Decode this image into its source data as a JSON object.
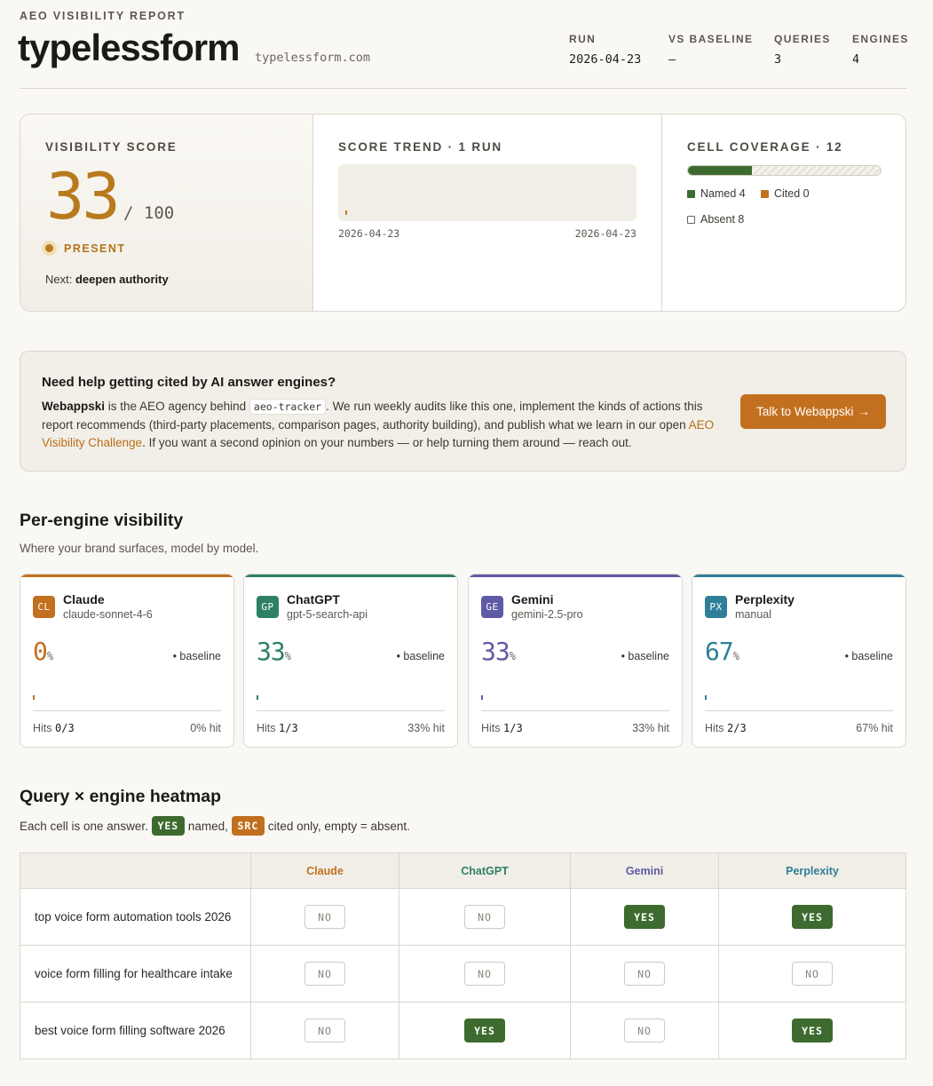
{
  "header": {
    "eyebrow": "AEO VISIBILITY REPORT",
    "brand": "typelessform",
    "domain": "typelessform.com",
    "meta": [
      {
        "label": "RUN",
        "value": "2026-04-23"
      },
      {
        "label": "VS BASELINE",
        "value": "—"
      },
      {
        "label": "QUERIES",
        "value": "3"
      },
      {
        "label": "ENGINES",
        "value": "4"
      }
    ]
  },
  "score": {
    "title": "VISIBILITY SCORE",
    "value": "33",
    "out_of": "/ 100",
    "status": "PRESENT",
    "next_label": "Next:",
    "next_value": "deepen authority"
  },
  "trend": {
    "title": "SCORE TREND · 1 RUN",
    "start_date": "2026-04-23",
    "end_date": "2026-04-23"
  },
  "coverage": {
    "title": "CELL COVERAGE · 12",
    "named_label": "Named 4",
    "cited_label": "Cited 0",
    "absent_label": "Absent 8",
    "named": 4,
    "cited": 0,
    "absent": 8,
    "total": 12,
    "colors": {
      "named": "#3d6b2f",
      "cited": "#c2701f"
    }
  },
  "cta": {
    "heading": "Need help getting cited by AI answer engines?",
    "p1_bold": "Webappski",
    "p1_a": " is the AEO agency behind ",
    "code": "aeo-tracker",
    "p1_b": ". We run weekly audits like this one, implement the kinds of actions this report recommends (third-party placements, comparison pages, authority building), and publish what we learn in our open ",
    "link": "AEO Visibility Challenge",
    "p1_c": ". If you want a second opinion on your numbers — or help turning them around — reach out.",
    "button": "Talk to Webappski",
    "button_icon": "→"
  },
  "engines_section": {
    "heading": "Per-engine visibility",
    "subheading": "Where your brand surfaces, model by model."
  },
  "engines": [
    {
      "abbr": "CL",
      "name": "Claude",
      "model": "claude-sonnet-4-6",
      "pct": "0",
      "pct_unit": "%",
      "baseline": "• baseline",
      "hits_label": "Hits",
      "hits": "0/3",
      "hit_pct": "0% hit",
      "color": "#c2701f"
    },
    {
      "abbr": "GP",
      "name": "ChatGPT",
      "model": "gpt-5-search-api",
      "pct": "33",
      "pct_unit": "%",
      "baseline": "• baseline",
      "hits_label": "Hits",
      "hits": "1/3",
      "hit_pct": "33% hit",
      "color": "#2e8066"
    },
    {
      "abbr": "GE",
      "name": "Gemini",
      "model": "gemini-2.5-pro",
      "pct": "33",
      "pct_unit": "%",
      "baseline": "• baseline",
      "hits_label": "Hits",
      "hits": "1/3",
      "hit_pct": "33% hit",
      "color": "#5e5aa6"
    },
    {
      "abbr": "PX",
      "name": "Perplexity",
      "model": "manual",
      "pct": "67",
      "pct_unit": "%",
      "baseline": "• baseline",
      "hits_label": "Hits",
      "hits": "2/3",
      "hit_pct": "67% hit",
      "color": "#2f7f98"
    }
  ],
  "heatmap": {
    "heading": "Query × engine heatmap",
    "legend_a": "Each cell is one answer.",
    "legend_yes": "YES",
    "legend_b": "named,",
    "legend_src": "SRC",
    "legend_c": "cited only, empty = absent.",
    "columns": [
      "Claude",
      "ChatGPT",
      "Gemini",
      "Perplexity"
    ],
    "rows": [
      {
        "query": "top voice form automation tools 2026",
        "cells": [
          "NO",
          "NO",
          "YES",
          "YES"
        ]
      },
      {
        "query": "voice form filling for healthcare intake",
        "cells": [
          "NO",
          "NO",
          "NO",
          "NO"
        ]
      },
      {
        "query": "best voice form filling software 2026",
        "cells": [
          "NO",
          "YES",
          "NO",
          "YES"
        ]
      }
    ]
  }
}
